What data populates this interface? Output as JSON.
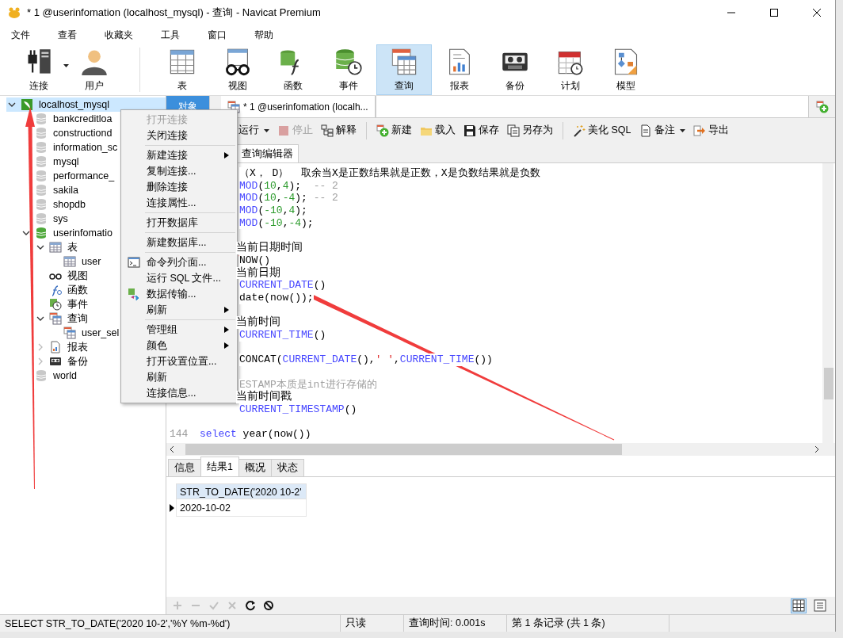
{
  "window": {
    "title": "* 1 @userinfomation (localhost_mysql) - 查询 - Navicat Premium"
  },
  "menu_bar": [
    "文件",
    "查看",
    "收藏夹",
    "工具",
    "窗口",
    "帮助"
  ],
  "toolbar_groups": [
    [
      {
        "label": "连接",
        "kind": "connection",
        "selected": false,
        "dropdown": true
      },
      {
        "label": "用户",
        "kind": "user",
        "selected": false,
        "dropdown": false
      }
    ],
    [
      {
        "label": "表",
        "kind": "table",
        "selected": false,
        "dropdown": false
      },
      {
        "label": "视图",
        "kind": "view",
        "selected": false,
        "dropdown": false
      },
      {
        "label": "函数",
        "kind": "function",
        "selected": false,
        "dropdown": false
      },
      {
        "label": "事件",
        "kind": "event",
        "selected": false,
        "dropdown": false
      },
      {
        "label": "查询",
        "kind": "query",
        "selected": true,
        "dropdown": false
      },
      {
        "label": "报表",
        "kind": "report",
        "selected": false,
        "dropdown": false
      },
      {
        "label": "备份",
        "kind": "backup",
        "selected": false,
        "dropdown": false
      },
      {
        "label": "计划",
        "kind": "schedule",
        "selected": false,
        "dropdown": false
      },
      {
        "label": "模型",
        "kind": "model",
        "selected": false,
        "dropdown": false
      }
    ]
  ],
  "tree": [
    {
      "label": "localhost_mysql",
      "kind": "connection",
      "selected": true,
      "expanded": true,
      "children": [
        {
          "label": "bankcreditloa",
          "kind": "database",
          "selected": false
        },
        {
          "label": "constructiond",
          "kind": "database",
          "selected": false
        },
        {
          "label": "information_sc",
          "kind": "database",
          "selected": false
        },
        {
          "label": "mysql",
          "kind": "database",
          "selected": false
        },
        {
          "label": "performance_",
          "kind": "database",
          "selected": false
        },
        {
          "label": "sakila",
          "kind": "database",
          "selected": false
        },
        {
          "label": "shopdb",
          "kind": "database",
          "selected": false
        },
        {
          "label": "sys",
          "kind": "database",
          "selected": false
        },
        {
          "label": "userinfomatio",
          "kind": "database",
          "selected": false,
          "expanded": true,
          "children": [
            {
              "label": "表",
              "kind": "tables",
              "selected": false,
              "expanded": true,
              "children": [
                {
                  "label": "user",
                  "kind": "table",
                  "selected": false
                }
              ]
            },
            {
              "label": "视图",
              "kind": "views",
              "selected": false
            },
            {
              "label": "函数",
              "kind": "functions",
              "selected": false
            },
            {
              "label": "事件",
              "kind": "events",
              "selected": false
            },
            {
              "label": "查询",
              "kind": "queries",
              "selected": false,
              "expanded": true,
              "children": [
                {
                  "label": "user_sel",
                  "kind": "query",
                  "selected": false
                }
              ]
            },
            {
              "label": "报表",
              "kind": "reports",
              "selected": false,
              "expanded": false
            },
            {
              "label": "备份",
              "kind": "backups",
              "selected": false,
              "expanded": false
            }
          ]
        },
        {
          "label": "world",
          "kind": "database",
          "selected": false
        }
      ]
    }
  ],
  "doc_tabs": [
    {
      "label": "对象",
      "kind": "object",
      "selected": false
    },
    {
      "label": "* 1 @userinfomation (localh...",
      "kind": "query",
      "selected": true
    }
  ],
  "editor_toolbar": [
    [
      {
        "label": "运行",
        "kind": "run",
        "dropdown": true,
        "disabled": false
      },
      {
        "label": "停止",
        "kind": "stop",
        "dropdown": false,
        "disabled": true
      },
      {
        "label": "解释",
        "kind": "explain",
        "dropdown": false,
        "disabled": false
      }
    ],
    [
      {
        "label": "新建",
        "kind": "new",
        "dropdown": false,
        "disabled": false
      },
      {
        "label": "载入",
        "kind": "load",
        "dropdown": false,
        "disabled": false
      },
      {
        "label": "保存",
        "kind": "save",
        "dropdown": false,
        "disabled": false
      },
      {
        "label": "另存为",
        "kind": "save-as",
        "dropdown": false,
        "disabled": false
      }
    ],
    [
      {
        "label": "美化 SQL",
        "kind": "beautify",
        "dropdown": false,
        "disabled": false
      },
      {
        "label": "备注",
        "kind": "comment",
        "dropdown": true,
        "disabled": false
      },
      {
        "label": "导出",
        "kind": "export",
        "dropdown": false,
        "disabled": false
      }
    ]
  ],
  "editor_tabs": [
    {
      "label": "查询编辑器",
      "selected": true
    }
  ],
  "editor_lines": [
    {
      "kind": "partial",
      "segments": [
        {
          "text": "（X， D）  取余当X是正数结果就是正数，X是负数结果就是负数",
          "kind": "plain"
        }
      ]
    },
    {
      "kind": "partial",
      "segments": [
        {
          "text": "MOD",
          "kind": "keyword"
        },
        {
          "text": "(",
          "kind": "plain"
        },
        {
          "text": "10",
          "kind": "number"
        },
        {
          "text": ",",
          "kind": "plain"
        },
        {
          "text": "4",
          "kind": "number"
        },
        {
          "text": ");",
          "kind": "plain"
        },
        {
          "text": "  -- 2",
          "kind": "comment"
        }
      ]
    },
    {
      "kind": "partial",
      "segments": [
        {
          "text": "MOD",
          "kind": "keyword"
        },
        {
          "text": "(",
          "kind": "plain"
        },
        {
          "text": "10",
          "kind": "number"
        },
        {
          "text": ",",
          "kind": "plain"
        },
        {
          "text": "-4",
          "kind": "number"
        },
        {
          "text": "); ",
          "kind": "plain"
        },
        {
          "text": "-- 2",
          "kind": "comment"
        }
      ]
    },
    {
      "kind": "partial",
      "segments": [
        {
          "text": "MOD",
          "kind": "keyword"
        },
        {
          "text": "(",
          "kind": "plain"
        },
        {
          "text": "-10",
          "kind": "number"
        },
        {
          "text": ",",
          "kind": "plain"
        },
        {
          "text": "4",
          "kind": "number"
        },
        {
          "text": ");",
          "kind": "plain"
        }
      ]
    },
    {
      "kind": "partial",
      "segments": [
        {
          "text": "MOD",
          "kind": "keyword"
        },
        {
          "text": "(",
          "kind": "plain"
        },
        {
          "text": "-10",
          "kind": "number"
        },
        {
          "text": ",",
          "kind": "plain"
        },
        {
          "text": "-4",
          "kind": "number"
        },
        {
          "text": ");",
          "kind": "plain"
        }
      ]
    },
    {
      "kind": "blank"
    },
    {
      "kind": "comment-partial",
      "segments": [
        {
          "text": "当前日期时间",
          "kind": "plain"
        }
      ]
    },
    {
      "kind": "partial",
      "segments": [
        {
          "text": "NOW()",
          "kind": "plain"
        }
      ]
    },
    {
      "kind": "comment-partial",
      "segments": [
        {
          "text": "当前日期",
          "kind": "plain"
        }
      ]
    },
    {
      "kind": "partial",
      "segments": [
        {
          "text": "CURRENT_DATE",
          "kind": "keyword"
        },
        {
          "text": "()",
          "kind": "plain"
        }
      ]
    },
    {
      "kind": "partial",
      "segments": [
        {
          "text": "date(now());",
          "kind": "plain"
        }
      ]
    },
    {
      "kind": "blank"
    },
    {
      "kind": "comment-partial",
      "segments": [
        {
          "text": "当前时间",
          "kind": "plain"
        }
      ]
    },
    {
      "kind": "partial",
      "segments": [
        {
          "text": "CURRENT_TIME",
          "kind": "keyword"
        },
        {
          "text": "()",
          "kind": "plain"
        }
      ]
    },
    {
      "kind": "blank"
    },
    {
      "kind": "partial",
      "segments": [
        {
          "text": "CONCAT(",
          "kind": "plain"
        },
        {
          "text": "CURRENT_DATE",
          "kind": "keyword"
        },
        {
          "text": "(),",
          "kind": "plain"
        },
        {
          "text": "' '",
          "kind": "string"
        },
        {
          "text": ",",
          "kind": "plain"
        },
        {
          "text": "CURRENT_TIME",
          "kind": "keyword"
        },
        {
          "text": "())",
          "kind": "plain"
        }
      ]
    },
    {
      "kind": "blank"
    },
    {
      "kind": "partial",
      "segments": [
        {
          "text": "ESTAMP本质是int进行存储的",
          "kind": "comment"
        }
      ]
    },
    {
      "kind": "comment-partial",
      "segments": [
        {
          "text": "当前时间戳",
          "kind": "plain"
        }
      ]
    },
    {
      "kind": "partial",
      "segments": [
        {
          "text": "CURRENT_TIMESTAMP",
          "kind": "keyword"
        },
        {
          "text": "()",
          "kind": "plain"
        }
      ]
    },
    {
      "kind": "blank"
    },
    {
      "kind": "full",
      "number": "144",
      "segments": [
        {
          "text": "select",
          "kind": "keyword"
        },
        {
          "text": " year(now())",
          "kind": "plain"
        }
      ]
    }
  ],
  "context_menu": [
    [
      {
        "label": "打开连接",
        "kind": "plain",
        "disabled": true,
        "submenu": false
      },
      {
        "label": "关闭连接",
        "kind": "plain",
        "disabled": false,
        "submenu": false
      }
    ],
    [
      {
        "label": "新建连接",
        "kind": "plain",
        "disabled": false,
        "submenu": true
      },
      {
        "label": "复制连接...",
        "kind": "plain",
        "disabled": false,
        "submenu": false
      },
      {
        "label": "删除连接",
        "kind": "plain",
        "disabled": false,
        "submenu": false
      },
      {
        "label": "连接属性...",
        "kind": "plain",
        "disabled": false,
        "submenu": false
      }
    ],
    [
      {
        "label": "打开数据库",
        "kind": "plain",
        "disabled": false,
        "submenu": false
      }
    ],
    [
      {
        "label": "新建数据库...",
        "kind": "plain",
        "disabled": false,
        "submenu": false
      }
    ],
    [
      {
        "label": "命令列介面...",
        "kind": "console",
        "disabled": false,
        "submenu": false
      },
      {
        "label": "运行 SQL 文件...",
        "kind": "plain",
        "disabled": false,
        "submenu": false
      },
      {
        "label": "数据传输...",
        "kind": "transfer",
        "disabled": false,
        "submenu": false
      },
      {
        "label": "刷新",
        "kind": "plain",
        "disabled": false,
        "submenu": true
      }
    ],
    [
      {
        "label": "管理组",
        "kind": "plain",
        "disabled": false,
        "submenu": true
      },
      {
        "label": "颜色",
        "kind": "plain",
        "disabled": false,
        "submenu": true
      },
      {
        "label": "打开设置位置...",
        "kind": "plain",
        "disabled": false,
        "submenu": false
      },
      {
        "label": "刷新",
        "kind": "plain",
        "disabled": false,
        "submenu": false
      },
      {
        "label": "连接信息...",
        "kind": "plain",
        "disabled": false,
        "submenu": false
      }
    ]
  ],
  "result_tabs": [
    {
      "label": "信息",
      "selected": false
    },
    {
      "label": "结果1",
      "selected": true
    },
    {
      "label": "概况",
      "selected": false
    },
    {
      "label": "状态",
      "selected": false
    }
  ],
  "result_grid": {
    "columns": [
      "STR_TO_DATE('2020 10-2'"
    ],
    "rows": [
      {
        "cells": [
          "2020-10-02"
        ],
        "current": true
      }
    ]
  },
  "grid_actions": [
    {
      "kind": "add",
      "disabled": true
    },
    {
      "kind": "delete",
      "disabled": true
    },
    {
      "kind": "apply",
      "disabled": true
    },
    {
      "kind": "discard",
      "disabled": true
    },
    {
      "kind": "refresh",
      "disabled": false
    },
    {
      "kind": "stop",
      "disabled": false
    }
  ],
  "view_modes": [
    {
      "kind": "grid",
      "selected": true
    },
    {
      "kind": "form",
      "selected": false
    }
  ],
  "status_bar": [
    "SELECT STR_TO_DATE('2020 10-2','%Y  %m-%d')",
    "只读",
    "查询时间: 0.001s",
    "第 1 条记录 (共 1 条)"
  ]
}
